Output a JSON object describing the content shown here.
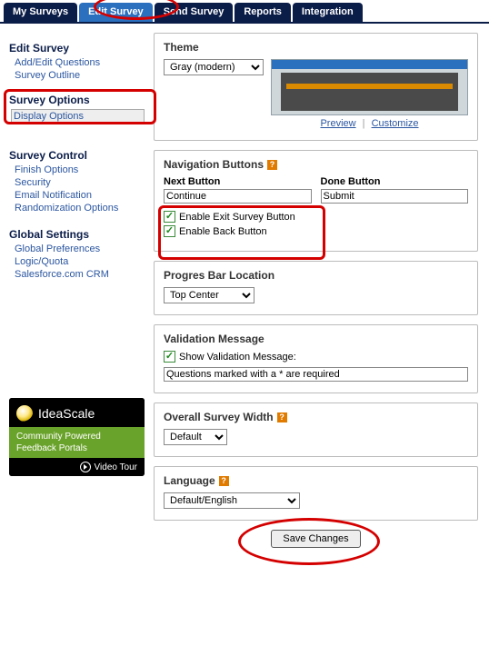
{
  "tabs": {
    "my_surveys": "My Surveys",
    "edit_survey": "Edit Survey",
    "send_survey": "Send Survey",
    "reports": "Reports",
    "integration": "Integration"
  },
  "sidebar": {
    "edit_survey": "Edit Survey",
    "add_edit_questions": "Add/Edit Questions",
    "survey_outline": "Survey Outline",
    "survey_options": "Survey Options",
    "display_options": "Display Options",
    "survey_control": "Survey Control",
    "finish_options": "Finish Options",
    "security": "Security",
    "email_notification": "Email Notification",
    "randomization_options": "Randomization Options",
    "global_settings": "Global Settings",
    "global_preferences": "Global Preferences",
    "logic_quota": "Logic/Quota",
    "salesforce_crm": "Salesforce.com CRM"
  },
  "ideascale": {
    "title": "IdeaScale",
    "tagline": "Community Powered Feedback Portals",
    "video_tour": "Video Tour"
  },
  "theme": {
    "title": "Theme",
    "value": "Gray (modern)",
    "preview_label": "Preview",
    "customize_label": "Customize"
  },
  "nav": {
    "title": "Navigation Buttons",
    "next_label": "Next Button",
    "next_value": "Continue",
    "done_label": "Done Button",
    "done_value": "Submit",
    "enable_exit": "Enable Exit Survey Button",
    "enable_back": "Enable Back Button"
  },
  "progress": {
    "title": "Progres Bar Location",
    "value": "Top Center"
  },
  "validation": {
    "title": "Validation Message",
    "checkbox_label": "Show Validation Message:",
    "value": "Questions marked with a * are required"
  },
  "width": {
    "title": "Overall Survey Width",
    "value": "Default"
  },
  "language": {
    "title": "Language",
    "value": "Default/English"
  },
  "save_label": "Save Changes"
}
